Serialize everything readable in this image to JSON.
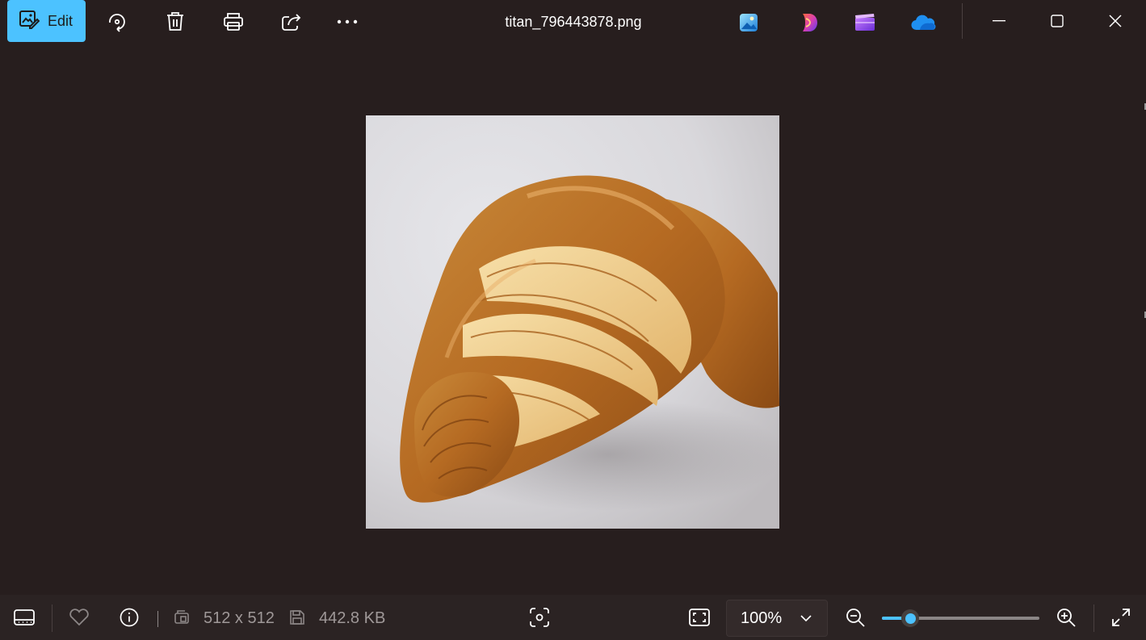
{
  "toolbar": {
    "edit_label": "Edit",
    "file_name": "titan_796443878.png"
  },
  "icons": {
    "edit": "edit-image-icon",
    "rotate": "rotate-icon",
    "delete": "trash-icon",
    "print": "printer-icon",
    "share": "share-icon",
    "more": "more-options-icon",
    "photos_app": "photos-app-icon",
    "copilot": "copilot-app-icon",
    "clipchamp": "clipchamp-app-icon",
    "onedrive": "onedrive-app-icon",
    "minimize": "minimize-icon",
    "maximize": "maximize-icon",
    "close": "close-icon",
    "filmstrip": "filmstrip-icon",
    "favorite": "heart-icon",
    "info": "info-icon",
    "resolution": "resolution-icon",
    "file_size": "save-disk-icon",
    "visual_search": "visual-search-icon",
    "fit_window": "fit-to-window-icon",
    "zoom_out": "zoom-out-icon",
    "zoom_in": "zoom-in-icon",
    "fullscreen": "fullscreen-icon",
    "dropdown": "chevron-down-icon"
  },
  "statusbar": {
    "resolution": "512 x 512",
    "file_size": "442.8 KB",
    "zoom_level": "100%",
    "zoom_slider_fraction": 0.18
  },
  "colors": {
    "accent": "#4cc2ff",
    "background": "#271e1e",
    "statusbar": "#2b2323"
  }
}
